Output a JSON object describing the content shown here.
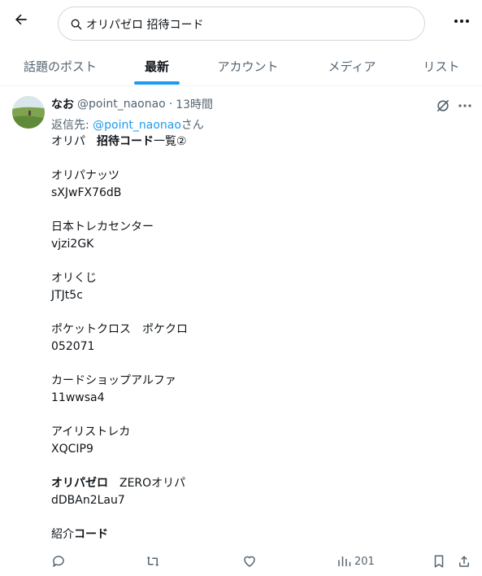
{
  "search": {
    "value": "オリパゼロ 招待コード"
  },
  "tabs": [
    "話題のポスト",
    "最新",
    "アカウント",
    "メディア",
    "リスト"
  ],
  "active_tab": "最新",
  "tweet": {
    "author_name": "なお",
    "handle": "@point_naonao",
    "dot": "·",
    "time": "13時間",
    "reply_prefix": "返信先: ",
    "reply_handle": "@point_naonao",
    "reply_suffix": "さん",
    "title_a": "オリパ　",
    "title_b": "招待コード",
    "title_c": "一覧②",
    "entries": [
      {
        "name": "オリパナッツ",
        "code": "sXJwFX76dB"
      },
      {
        "name": "日本トレカセンター",
        "code": "vjzi2GK"
      },
      {
        "name": "オリくじ",
        "code": "JTJt5c"
      },
      {
        "name": "ポケットクロス　ポケクロ",
        "code": "052071"
      },
      {
        "name": "カードショップアルファ",
        "code": "11wwsa4"
      },
      {
        "name": "アイリストレカ",
        "code": "XQCIP9"
      }
    ],
    "zero_bold": "オリパゼロ",
    "zero_rest": "　ZEROオリパ",
    "zero_code": "dDBAn2Lau7",
    "intro_a": "紹介",
    "intro_b": "コード",
    "views": "201"
  },
  "icons": [
    "back-arrow-icon",
    "search-icon",
    "more-icon",
    "grok-icon",
    "reply-icon",
    "retweet-icon",
    "like-icon",
    "views-icon",
    "bookmark-icon",
    "share-icon"
  ],
  "colors": {
    "accent": "#1d9bf0",
    "text": "#0f1419",
    "muted": "#536471",
    "border": "#eff3f4"
  }
}
